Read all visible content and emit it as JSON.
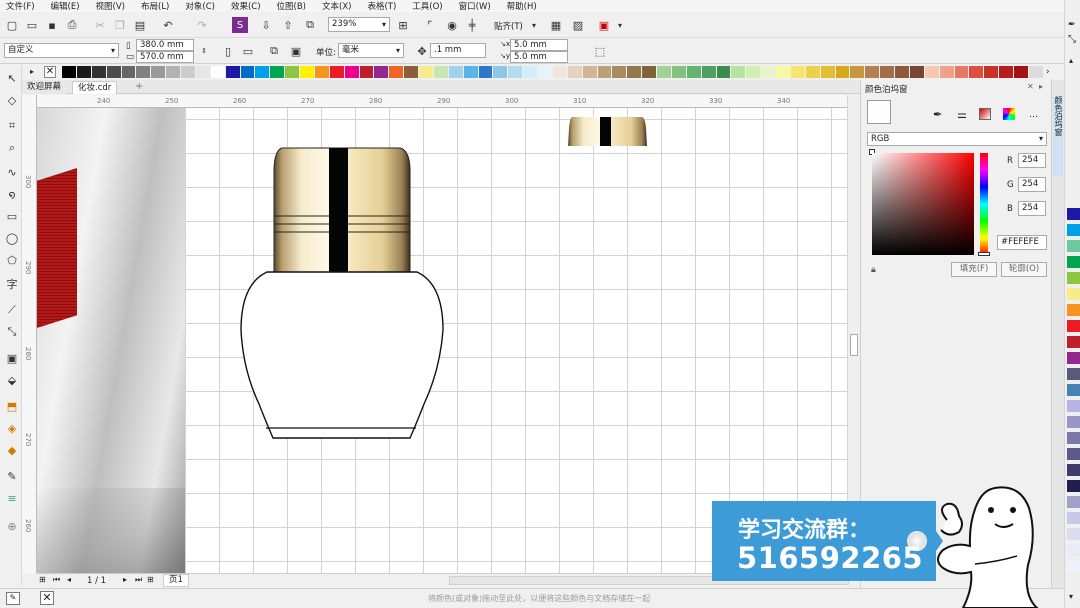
{
  "menu": [
    "文件(F)",
    "编辑(E)",
    "视图(V)",
    "布局(L)",
    "对象(C)",
    "效果(C)",
    "位图(B)",
    "文本(X)",
    "表格(T)",
    "工具(O)",
    "窗口(W)",
    "帮助(H)"
  ],
  "toolbar": {
    "zoom": "239%",
    "snap_label": "贴齐(T)"
  },
  "propbar": {
    "preset": "自定义",
    "width": "380.0 mm",
    "height": "570.0 mm",
    "unit_label": "单位:",
    "unit": "毫米",
    "nudge": ".1 mm",
    "dup_x": "5.0 mm",
    "dup_y": "5.0 mm"
  },
  "tabs": {
    "welcome": "欢迎屏幕",
    "doc": "化妆.cdr"
  },
  "ruler": {
    "h": [
      "240",
      "250",
      "260",
      "270",
      "280",
      "290",
      "300",
      "310",
      "320",
      "330",
      "340"
    ],
    "v": [
      "300",
      "290",
      "280",
      "270",
      "260"
    ]
  },
  "docker": {
    "title": "颜色泊坞窗",
    "model": "RGB",
    "r_label": "R",
    "g_label": "G",
    "b_label": "B",
    "r": "254",
    "g": "254",
    "b": "254",
    "hex": "#FEFEFE",
    "fill_btn": "填充(F)",
    "outline_btn": "轮廓(O)",
    "side_tab": "颜色泊坞窗"
  },
  "pagebar": {
    "page_count": "1 / 1",
    "page_tab": "页1"
  },
  "status": {
    "hint": "将颜色(或对象)拖动至此处，以便将这些颜色与文档存储在一起"
  },
  "banner": {
    "line1": "学习交流群：",
    "line2": "516592265"
  },
  "palette_colors": [
    "#000000",
    "#1a1a1a",
    "#333333",
    "#4d4d4d",
    "#666666",
    "#808080",
    "#999999",
    "#b3b3b3",
    "#cccccc",
    "#e6e6e6",
    "#ffffff",
    "#1a1aa6",
    "#006ec8",
    "#00a0e6",
    "#00a651",
    "#8dc63f",
    "#fff200",
    "#f7941d",
    "#ed1c24",
    "#ec008c",
    "#be1e2d",
    "#92278f",
    "#f26522",
    "#8b5e3c",
    "#f7ec8c",
    "#c8e6b4",
    "#a0d2f0",
    "#5ab4e6",
    "#2d78c8",
    "#8ec8e8",
    "#b4dcf0",
    "#d2eef8",
    "#e6f4fa",
    "#f0e6dc",
    "#e6d2be",
    "#d2b496",
    "#bea078",
    "#aa8c64",
    "#967850",
    "#82643c",
    "#a0d296",
    "#82c382",
    "#64b46e",
    "#50a064",
    "#3c8c50",
    "#b4e6a0",
    "#d2f0b4",
    "#e6f5c8",
    "#f5faa0",
    "#f5e66e",
    "#ebd24b",
    "#e1be32",
    "#d7aa1e",
    "#c8963c",
    "#b48250",
    "#a06e46",
    "#8c5a3c",
    "#784632",
    "#f5c8b4",
    "#f0a08c",
    "#e67864",
    "#dc503c",
    "#c83228",
    "#b41e1e",
    "#a01414",
    "#dcdcdc"
  ],
  "side_swatches": [
    "#1a1aa6",
    "#00a0e6",
    "#6ec8a0",
    "#00a651",
    "#8dc63f",
    "#f7ec8c",
    "#f7941d",
    "#ed1c24",
    "#be1e2d",
    "#92278f",
    "#5a5a7a",
    "#4682b4",
    "#b4b4e6",
    "#9696c8",
    "#7878aa",
    "#5a5a8c",
    "#3c3c6e",
    "#1e1e50",
    "#a0a0c8",
    "#c8c8e6",
    "#dcdcf0",
    "#ebebf5",
    "#f0f0fa"
  ]
}
